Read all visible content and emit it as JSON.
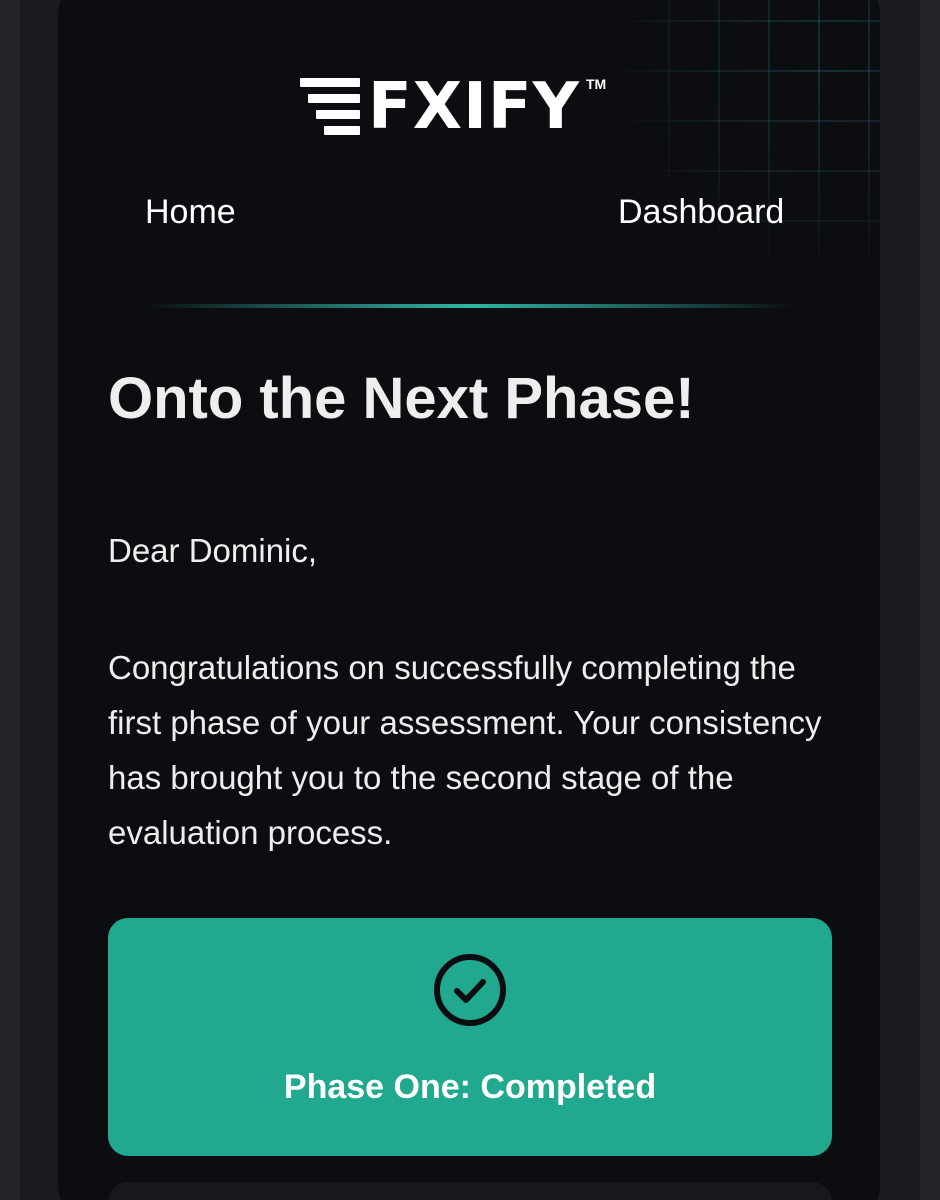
{
  "brand": {
    "name": "FXIFY",
    "trademark": "TM"
  },
  "nav": {
    "home": "Home",
    "dashboard": "Dashboard"
  },
  "email": {
    "title": "Onto the Next Phase!",
    "greeting": "Dear Dominic,",
    "body": "Congratulations on successfully completing the first phase of your assessment. Your consistency has brought you to the second stage of the evaluation process."
  },
  "status": {
    "icon": "check-circle-icon",
    "label": "Phase One: Completed"
  },
  "colors": {
    "accent": "#20a98e",
    "background": "#0c0d10",
    "text": "#eeeeee"
  }
}
